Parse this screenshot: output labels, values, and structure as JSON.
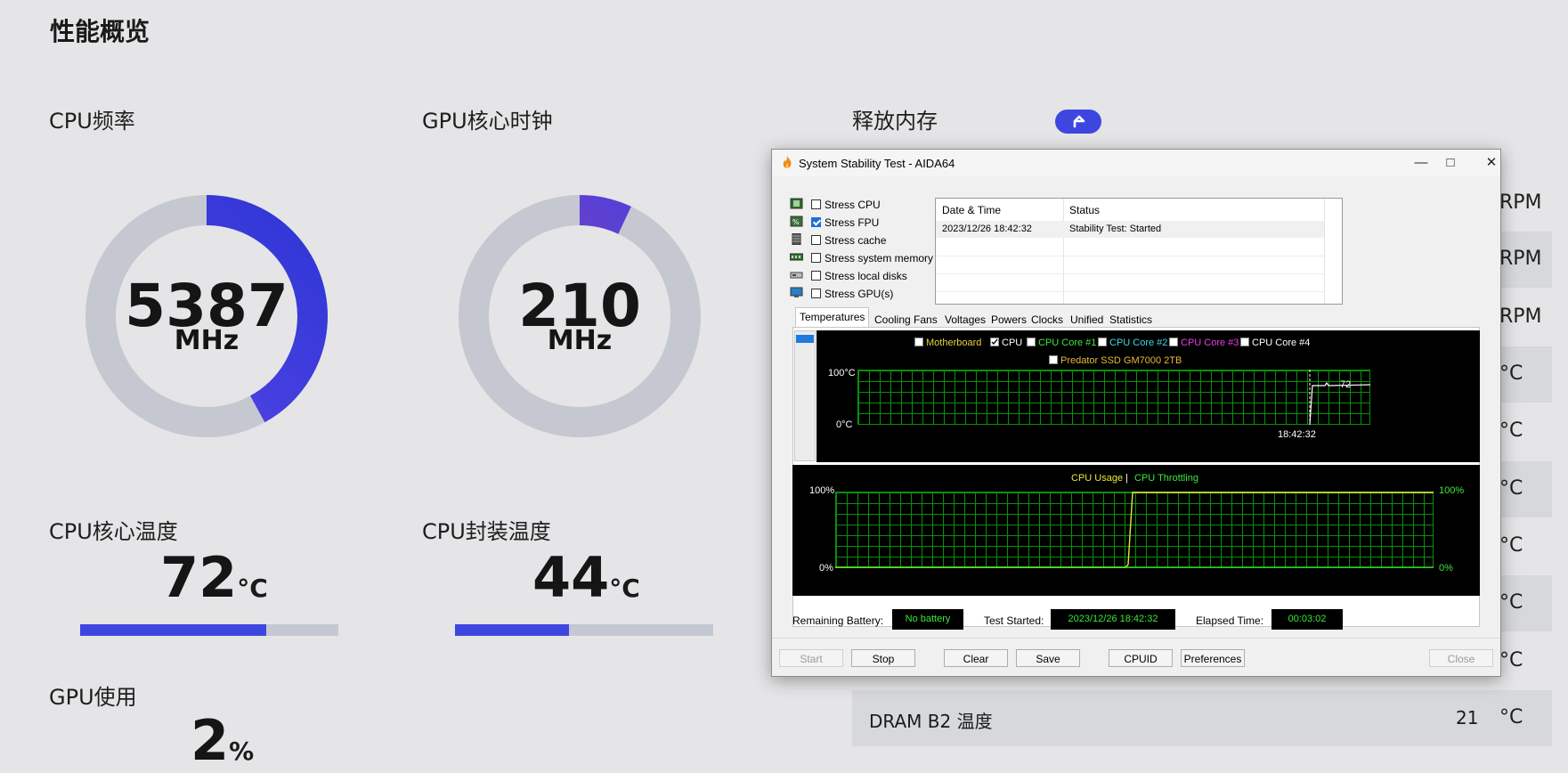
{
  "page": {
    "title": "性能概览"
  },
  "cpu_freq": {
    "label": "CPU频率",
    "value": "5387",
    "unit": "MHz",
    "fraction": 0.42
  },
  "gpu_clock": {
    "label": "GPU核心时钟",
    "value": "210",
    "unit": "MHz",
    "fraction": 0.07
  },
  "cpu_core_temp": {
    "label": "CPU核心温度",
    "value": "72",
    "unit": "°C",
    "fraction": 0.72
  },
  "cpu_pkg_temp": {
    "label": "CPU封装温度",
    "value": "44",
    "unit": "°C",
    "fraction": 0.44
  },
  "gpu_usage": {
    "label": "GPU使用",
    "value": "2",
    "unit": "%"
  },
  "release_mem": {
    "label": "释放内存",
    "icon": "arrow-up-right-icon",
    "accent": "#3d47e0"
  },
  "right_rows": [
    {
      "unit": "RPM"
    },
    {
      "unit": "RPM"
    },
    {
      "unit": "RPM"
    },
    {
      "unit": "°C"
    },
    {
      "unit": "°C"
    },
    {
      "unit": "°C"
    },
    {
      "unit": "°C"
    },
    {
      "unit": "°C"
    },
    {
      "unit": "°C"
    },
    {
      "name": "DRAM B2 温度",
      "value": "21",
      "unit": "°C"
    }
  ],
  "aida": {
    "title": "System Stability Test - AIDA64",
    "stress": [
      {
        "label": "Stress CPU",
        "checked": false,
        "icon": "cpu-icon"
      },
      {
        "label": "Stress FPU",
        "checked": true,
        "icon": "fpu-icon"
      },
      {
        "label": "Stress cache",
        "checked": false,
        "icon": "cache-icon"
      },
      {
        "label": "Stress system memory",
        "checked": false,
        "icon": "memory-icon"
      },
      {
        "label": "Stress local disks",
        "checked": false,
        "icon": "disk-icon"
      },
      {
        "label": "Stress GPU(s)",
        "checked": false,
        "icon": "gpu-icon"
      }
    ],
    "log": {
      "headers": [
        "Date & Time",
        "Status"
      ],
      "rows": [
        [
          "2023/12/26 18:42:32",
          "Stability Test: Started"
        ]
      ]
    },
    "tabs": [
      "Temperatures",
      "Cooling Fans",
      "Voltages",
      "Powers",
      "Clocks",
      "Unified",
      "Statistics"
    ],
    "temp_chart": {
      "legend": [
        {
          "label": "Motherboard",
          "checked": false,
          "color": "#e8d43a"
        },
        {
          "label": "CPU",
          "checked": true,
          "color": "#ffffff"
        },
        {
          "label": "CPU Core #1",
          "checked": false,
          "color": "#3ee83e"
        },
        {
          "label": "CPU Core #2",
          "checked": false,
          "color": "#3ed8e8"
        },
        {
          "label": "CPU Core #3",
          "checked": false,
          "color": "#e83ee8"
        },
        {
          "label": "CPU Core #4",
          "checked": false,
          "color": "#ffffff"
        },
        {
          "label": "Predator SSD GM7000 2TB",
          "checked": false,
          "color": "#e8b83a"
        }
      ],
      "y_top": "100°C",
      "y_bottom": "0°C",
      "x_label": "18:42:32",
      "current": "72"
    },
    "usage_chart": {
      "title_a": "CPU Usage",
      "sep": "|",
      "title_b": "CPU Throttling",
      "y_top_left": "100%",
      "y_bottom_left": "0%",
      "y_top_right": "100%",
      "y_bottom_right": "0%"
    },
    "status": {
      "battery_label": "Remaining Battery:",
      "battery_value": "No battery",
      "started_label": "Test Started:",
      "started_value": "2023/12/26 18:42:32",
      "elapsed_label": "Elapsed Time:",
      "elapsed_value": "00:03:02"
    },
    "buttons": {
      "start": "Start",
      "stop": "Stop",
      "clear": "Clear",
      "save": "Save",
      "cpuid": "CPUID",
      "preferences": "Preferences",
      "close": "Close"
    }
  }
}
